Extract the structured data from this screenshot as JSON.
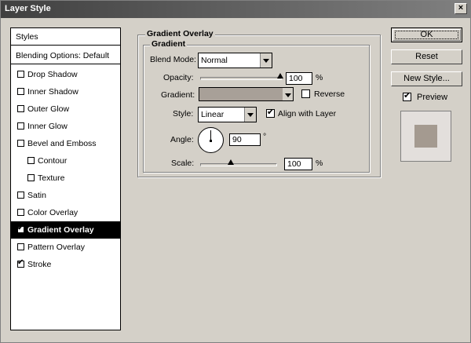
{
  "window": {
    "title": "Layer Style",
    "close_glyph": "×"
  },
  "styles_list": {
    "header": "Styles",
    "blending": "Blending Options: Default",
    "items": [
      {
        "label": "Drop Shadow",
        "checked": false,
        "indent": false
      },
      {
        "label": "Inner Shadow",
        "checked": false,
        "indent": false
      },
      {
        "label": "Outer Glow",
        "checked": false,
        "indent": false
      },
      {
        "label": "Inner Glow",
        "checked": false,
        "indent": false
      },
      {
        "label": "Bevel and Emboss",
        "checked": false,
        "indent": false
      },
      {
        "label": "Contour",
        "checked": false,
        "indent": true
      },
      {
        "label": "Texture",
        "checked": false,
        "indent": true
      },
      {
        "label": "Satin",
        "checked": false,
        "indent": false
      },
      {
        "label": "Color Overlay",
        "checked": false,
        "indent": false
      },
      {
        "label": "Gradient Overlay",
        "checked": true,
        "indent": false,
        "selected": true
      },
      {
        "label": "Pattern Overlay",
        "checked": false,
        "indent": false
      },
      {
        "label": "Stroke",
        "checked": true,
        "indent": false
      }
    ]
  },
  "panel": {
    "outer_title": "Gradient Overlay",
    "inner_title": "Gradient",
    "blend_mode_label": "Blend Mode:",
    "blend_mode_value": "Normal",
    "opacity_label": "Opacity:",
    "opacity_value": "100",
    "opacity_unit": "%",
    "opacity_fraction": 1.0,
    "gradient_label": "Gradient:",
    "gradient_color": "#a8a098",
    "reverse_label": "Reverse",
    "reverse_checked": false,
    "style_label": "Style:",
    "style_value": "Linear",
    "align_label": "Align with Layer",
    "align_checked": true,
    "angle_label": "Angle:",
    "angle_value": "90",
    "angle_unit": "°",
    "scale_label": "Scale:",
    "scale_value": "100",
    "scale_unit": "%",
    "scale_fraction": 0.41
  },
  "buttons": {
    "ok": "OK",
    "reset": "Reset",
    "new_style": "New Style...",
    "preview_label": "Preview",
    "preview_checked": true
  },
  "colors": {
    "preview_swatch": "#a49a90",
    "preview_bg": "#e3dfdc"
  }
}
